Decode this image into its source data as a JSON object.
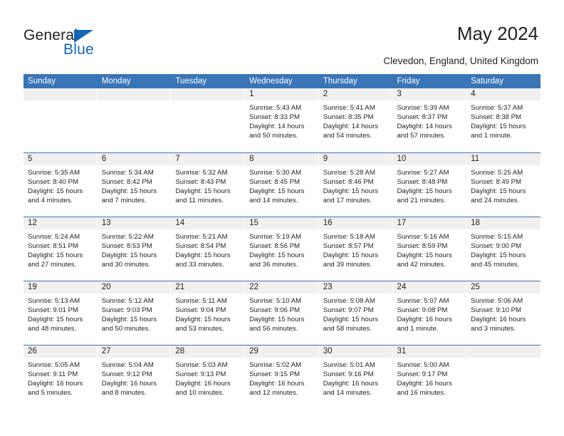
{
  "brand": {
    "name_part1": "General",
    "name_part2": "Blue",
    "triangle_icon": "triangle-icon",
    "accent_color": "#1266b5"
  },
  "header": {
    "title": "May 2024",
    "location": "Clevedon, England, United Kingdom"
  },
  "theme": {
    "header_blue": "#3975b7",
    "daynum_band": "#f0f0f0",
    "text": "#231f20"
  },
  "weekdays": [
    "Sunday",
    "Monday",
    "Tuesday",
    "Wednesday",
    "Thursday",
    "Friday",
    "Saturday"
  ],
  "weeks": [
    [
      {
        "day": "",
        "lines": []
      },
      {
        "day": "",
        "lines": []
      },
      {
        "day": "",
        "lines": []
      },
      {
        "day": "1",
        "lines": [
          "Sunrise: 5:43 AM",
          "Sunset: 8:33 PM",
          "Daylight: 14 hours",
          "and 50 minutes."
        ]
      },
      {
        "day": "2",
        "lines": [
          "Sunrise: 5:41 AM",
          "Sunset: 8:35 PM",
          "Daylight: 14 hours",
          "and 54 minutes."
        ]
      },
      {
        "day": "3",
        "lines": [
          "Sunrise: 5:39 AM",
          "Sunset: 8:37 PM",
          "Daylight: 14 hours",
          "and 57 minutes."
        ]
      },
      {
        "day": "4",
        "lines": [
          "Sunrise: 5:37 AM",
          "Sunset: 8:38 PM",
          "Daylight: 15 hours",
          "and 1 minute."
        ]
      }
    ],
    [
      {
        "day": "5",
        "lines": [
          "Sunrise: 5:35 AM",
          "Sunset: 8:40 PM",
          "Daylight: 15 hours",
          "and 4 minutes."
        ]
      },
      {
        "day": "6",
        "lines": [
          "Sunrise: 5:34 AM",
          "Sunset: 8:42 PM",
          "Daylight: 15 hours",
          "and 7 minutes."
        ]
      },
      {
        "day": "7",
        "lines": [
          "Sunrise: 5:32 AM",
          "Sunset: 8:43 PM",
          "Daylight: 15 hours",
          "and 11 minutes."
        ]
      },
      {
        "day": "8",
        "lines": [
          "Sunrise: 5:30 AM",
          "Sunset: 8:45 PM",
          "Daylight: 15 hours",
          "and 14 minutes."
        ]
      },
      {
        "day": "9",
        "lines": [
          "Sunrise: 5:28 AM",
          "Sunset: 8:46 PM",
          "Daylight: 15 hours",
          "and 17 minutes."
        ]
      },
      {
        "day": "10",
        "lines": [
          "Sunrise: 5:27 AM",
          "Sunset: 8:48 PM",
          "Daylight: 15 hours",
          "and 21 minutes."
        ]
      },
      {
        "day": "11",
        "lines": [
          "Sunrise: 5:25 AM",
          "Sunset: 8:49 PM",
          "Daylight: 15 hours",
          "and 24 minutes."
        ]
      }
    ],
    [
      {
        "day": "12",
        "lines": [
          "Sunrise: 5:24 AM",
          "Sunset: 8:51 PM",
          "Daylight: 15 hours",
          "and 27 minutes."
        ]
      },
      {
        "day": "13",
        "lines": [
          "Sunrise: 5:22 AM",
          "Sunset: 8:53 PM",
          "Daylight: 15 hours",
          "and 30 minutes."
        ]
      },
      {
        "day": "14",
        "lines": [
          "Sunrise: 5:21 AM",
          "Sunset: 8:54 PM",
          "Daylight: 15 hours",
          "and 33 minutes."
        ]
      },
      {
        "day": "15",
        "lines": [
          "Sunrise: 5:19 AM",
          "Sunset: 8:56 PM",
          "Daylight: 15 hours",
          "and 36 minutes."
        ]
      },
      {
        "day": "16",
        "lines": [
          "Sunrise: 5:18 AM",
          "Sunset: 8:57 PM",
          "Daylight: 15 hours",
          "and 39 minutes."
        ]
      },
      {
        "day": "17",
        "lines": [
          "Sunrise: 5:16 AM",
          "Sunset: 8:59 PM",
          "Daylight: 15 hours",
          "and 42 minutes."
        ]
      },
      {
        "day": "18",
        "lines": [
          "Sunrise: 5:15 AM",
          "Sunset: 9:00 PM",
          "Daylight: 15 hours",
          "and 45 minutes."
        ]
      }
    ],
    [
      {
        "day": "19",
        "lines": [
          "Sunrise: 5:13 AM",
          "Sunset: 9:01 PM",
          "Daylight: 15 hours",
          "and 48 minutes."
        ]
      },
      {
        "day": "20",
        "lines": [
          "Sunrise: 5:12 AM",
          "Sunset: 9:03 PM",
          "Daylight: 15 hours",
          "and 50 minutes."
        ]
      },
      {
        "day": "21",
        "lines": [
          "Sunrise: 5:11 AM",
          "Sunset: 9:04 PM",
          "Daylight: 15 hours",
          "and 53 minutes."
        ]
      },
      {
        "day": "22",
        "lines": [
          "Sunrise: 5:10 AM",
          "Sunset: 9:06 PM",
          "Daylight: 15 hours",
          "and 56 minutes."
        ]
      },
      {
        "day": "23",
        "lines": [
          "Sunrise: 5:08 AM",
          "Sunset: 9:07 PM",
          "Daylight: 15 hours",
          "and 58 minutes."
        ]
      },
      {
        "day": "24",
        "lines": [
          "Sunrise: 5:07 AM",
          "Sunset: 9:08 PM",
          "Daylight: 16 hours",
          "and 1 minute."
        ]
      },
      {
        "day": "25",
        "lines": [
          "Sunrise: 5:06 AM",
          "Sunset: 9:10 PM",
          "Daylight: 16 hours",
          "and 3 minutes."
        ]
      }
    ],
    [
      {
        "day": "26",
        "lines": [
          "Sunrise: 5:05 AM",
          "Sunset: 9:11 PM",
          "Daylight: 16 hours",
          "and 5 minutes."
        ]
      },
      {
        "day": "27",
        "lines": [
          "Sunrise: 5:04 AM",
          "Sunset: 9:12 PM",
          "Daylight: 16 hours",
          "and 8 minutes."
        ]
      },
      {
        "day": "28",
        "lines": [
          "Sunrise: 5:03 AM",
          "Sunset: 9:13 PM",
          "Daylight: 16 hours",
          "and 10 minutes."
        ]
      },
      {
        "day": "29",
        "lines": [
          "Sunrise: 5:02 AM",
          "Sunset: 9:15 PM",
          "Daylight: 16 hours",
          "and 12 minutes."
        ]
      },
      {
        "day": "30",
        "lines": [
          "Sunrise: 5:01 AM",
          "Sunset: 9:16 PM",
          "Daylight: 16 hours",
          "and 14 minutes."
        ]
      },
      {
        "day": "31",
        "lines": [
          "Sunrise: 5:00 AM",
          "Sunset: 9:17 PM",
          "Daylight: 16 hours",
          "and 16 minutes."
        ]
      },
      {
        "day": "",
        "lines": []
      }
    ]
  ]
}
